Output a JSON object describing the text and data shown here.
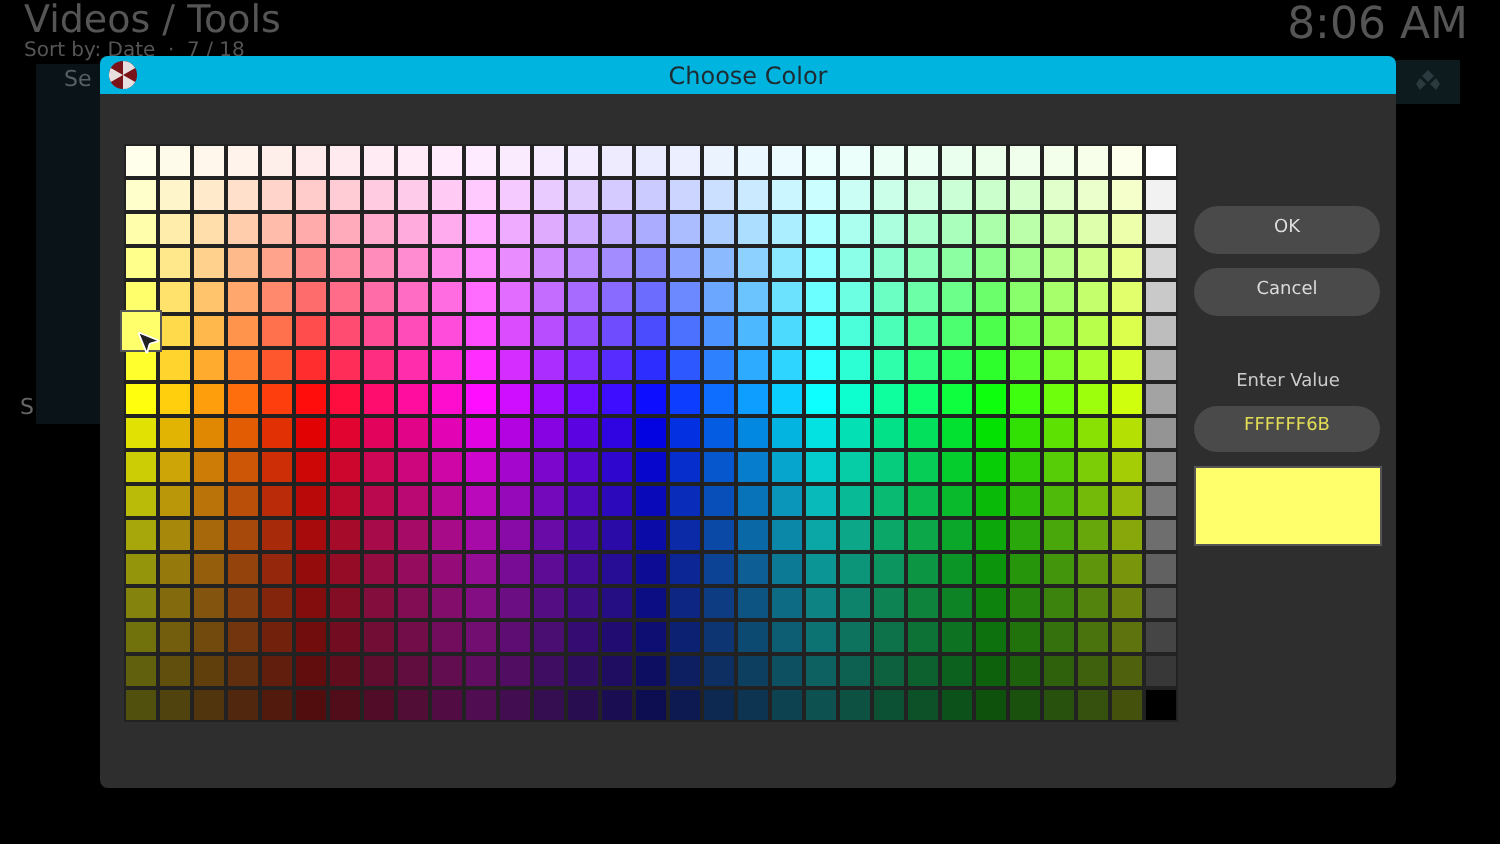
{
  "background": {
    "title": "Videos / Tools",
    "subtitle": "Sort by: Date  ·  7 / 18",
    "clock": "8:06 AM",
    "button_label": "Se",
    "side_label": "S"
  },
  "dialog": {
    "title": "Choose Color",
    "buttons": [
      "OK",
      "Cancel"
    ],
    "value_label": "Enter Value",
    "value": "FFFFFF6B"
  }
}
